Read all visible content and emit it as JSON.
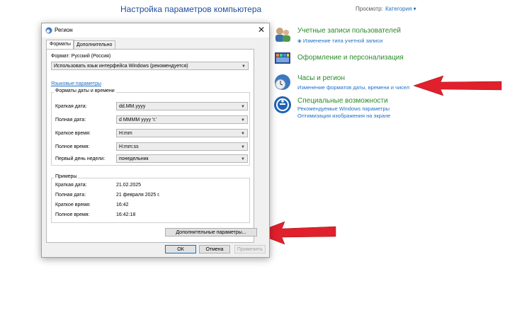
{
  "control_panel": {
    "title": "Настройка параметров компьютера",
    "view_by_label": "Просмотр:",
    "view_by_value": "Категория",
    "categories": [
      {
        "title": "Учетные записи пользователей",
        "links": [
          "Изменение типа учетной записи"
        ]
      },
      {
        "title": "Оформление и персонализация",
        "links": []
      },
      {
        "title": "Часы и регион",
        "links": [
          "Изменение форматов даты, времени и чисел"
        ]
      },
      {
        "title": "Специальные возможности",
        "links": [
          "Рекомендуемые Windows параметры",
          "Оптимизация изображения на экране"
        ]
      }
    ]
  },
  "dialog": {
    "title": "Регион",
    "tabs": [
      "Форматы",
      "Дополнительно"
    ],
    "format_label": "Формат: Русский (Россия)",
    "format_value": "Использовать язык интерфейса Windows (рекомендуется)",
    "language_link": "Языковые параметры",
    "datetime_group": "Форматы даты и времени",
    "fields": [
      {
        "label": "Краткая дата:",
        "value": "dd.MM.yyyy"
      },
      {
        "label": "Полная дата:",
        "value": "d MMMM yyyy 'г.'"
      },
      {
        "label": "Краткое время:",
        "value": "H:mm"
      },
      {
        "label": "Полное время:",
        "value": "H:mm:ss"
      },
      {
        "label": "Первый день недели:",
        "value": "понедельник"
      }
    ],
    "examples_group": "Примеры",
    "examples": [
      {
        "label": "Краткая дата:",
        "value": "21.02.2025"
      },
      {
        "label": "Полная дата:",
        "value": "21 февраля 2025 г."
      },
      {
        "label": "Краткое время:",
        "value": "16:42"
      },
      {
        "label": "Полное время:",
        "value": "16:42:18"
      }
    ],
    "advanced_button": "Дополнительные параметры...",
    "ok_button": "ОК",
    "cancel_button": "Отмена",
    "apply_button": "Применить"
  },
  "colors": {
    "arrow": "#e0202c",
    "link": "#1f6fc5",
    "category_title": "#2a8a2a"
  }
}
